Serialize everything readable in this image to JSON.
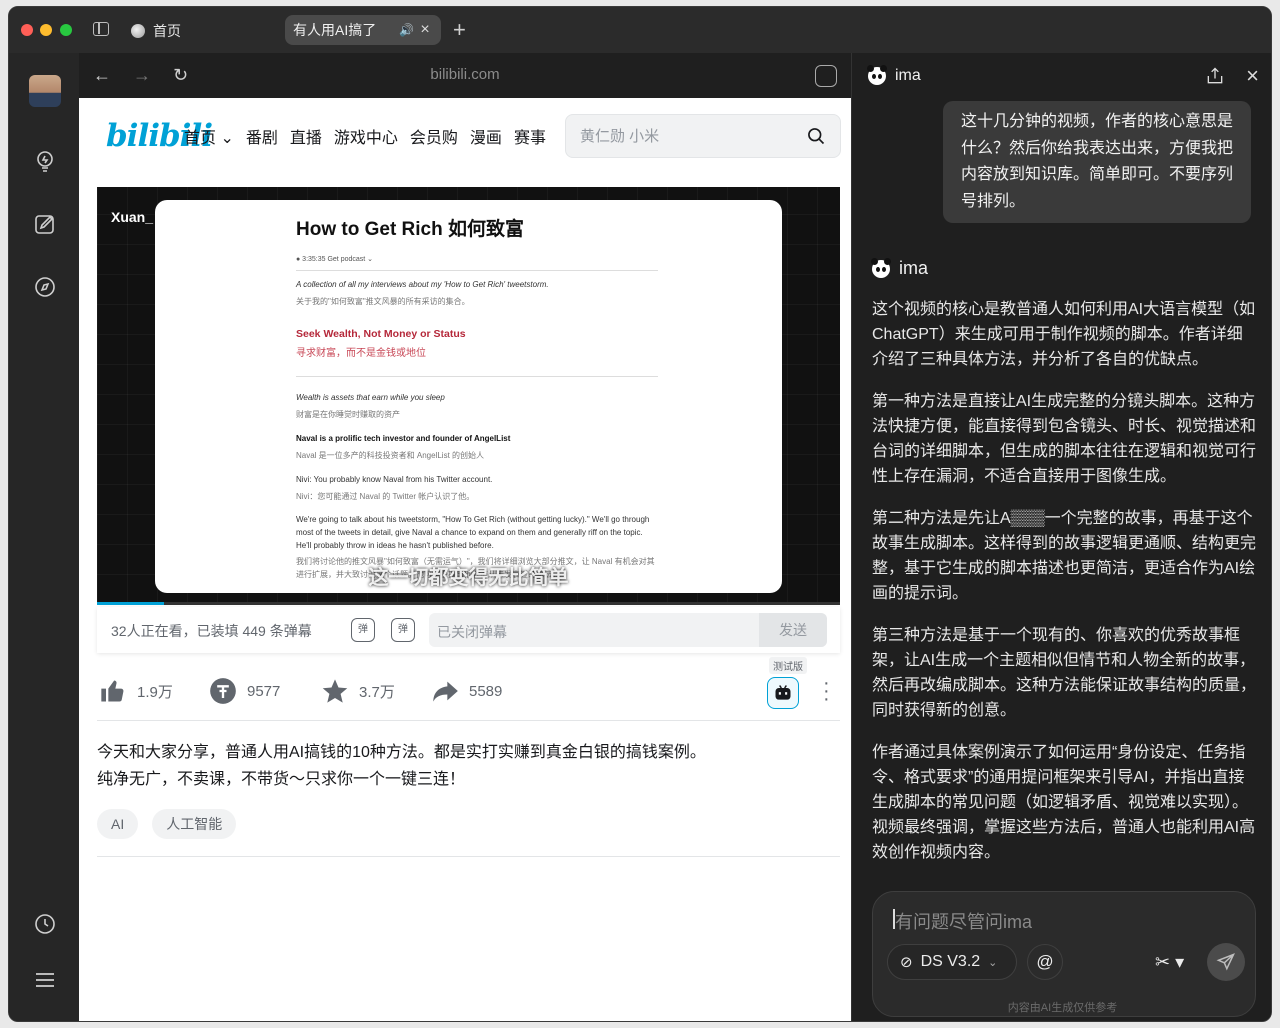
{
  "window": {
    "tabs": [
      {
        "label": "首页"
      },
      {
        "label": "有人用AI搞了"
      }
    ]
  },
  "browser": {
    "url": "bilibili.com"
  },
  "bilibili": {
    "logo": "bilibili",
    "nav": [
      "首页 ⌄",
      "番剧",
      "直播",
      "游戏中心",
      "会员购",
      "漫画",
      "赛事"
    ],
    "search_placeholder": "黄仁勋 小米",
    "video": {
      "watermark": "Xuan_",
      "watermark_logo": "bilibili",
      "slide_title": "How to Get Rich 如何致富",
      "slide_meta": "● 3:35:35   Get podcast ⌄",
      "slide_lines": {
        "l1": "A collection of all my interviews about my 'How to Get Rich' tweetstorm.",
        "l2": "关于我的\"如何致富\"推文风暴的所有采访的集合。",
        "l3": "Seek Wealth, Not Money or Status",
        "l4": "寻求财富，而不是金钱或地位",
        "l5": "Wealth is assets that earn while you sleep",
        "l6": "财富是在你睡觉时赚取的资产",
        "l7": "Naval is a prolific tech investor and founder of AngelList",
        "l8": "Naval 是一位多产的科技投资者和 AngelList 的创始人",
        "l9": "Nivi: You probably know Naval from his Twitter account.",
        "l10": "Nivi：您可能通过 Naval 的 Twitter 帐户认识了他。",
        "l11": "We're going to talk about his tweetstorm, \"How To Get Rich (without getting lucky).\" We'll go through most of the tweets in detail, give Naval a chance to expand on them and generally riff on the topic. He'll probably throw in ideas he hasn't published before.",
        "l12": "我们将讨论他的推文风暴\"如何致富（无需运气）\"，我们将详细浏览大部分推文，让 Naval 有机会对其进行扩展，并大致讨论这个话题。他可能会提出他以前从未发表过的想法。"
      },
      "subtitle": "这一切都变得无比简单"
    },
    "danmaku": {
      "info": "32人正在看，已装填 449 条弹幕",
      "placeholder": "已关闭弹幕",
      "send": "发送"
    },
    "actions": {
      "like": "1.9万",
      "coin": "9577",
      "favorite": "3.7万",
      "share": "5589",
      "ai_tag": "测试版"
    },
    "description": [
      "今天和大家分享，普通人用AI搞钱的10种方法。都是实打实赚到真金白银的搞钱案例。",
      "纯净无广，不卖课，不带货～只求你一个一键三连！"
    ],
    "tags": [
      "AI",
      "人工智能"
    ]
  },
  "assistant": {
    "name": "ima",
    "user_message": "这十几分钟的视频，作者的核心意思是什么？然后你给我表达出来，方便我把内容放到知识库。简单即可。不要序列号排列。",
    "reply_name": "ima",
    "reply_paragraphs": [
      "这个视频的核心是教普通人如何利用AI大语言模型（如ChatGPT）来生成可用于制作视频的脚本。作者详细介绍了三种具体方法，并分析了各自的优缺点。",
      "第一种方法是直接让AI生成完整的分镜头脚本。这种方法快捷方便，能直接得到包含镜头、时长、视觉描述和台词的详细脚本，但生成的脚本往往在逻辑和视觉可行性上存在漏洞，不适合直接用于图像生成。",
      "第二种方法是先让A▒▒▒一个完整的故事，再基于这个故事生成脚本。这样得到的故事逻辑更通顺、结构更完整，基于它生成的脚本描述也更简洁，更适合作为AI绘画的提示词。",
      "第三种方法是基于一个现有的、你喜欢的优秀故事框架，让AI生成一个主题相似但情节和人物全新的故事，然后再改编成脚本。这种方法能保证故事结构的质量，同时获得新的创意。",
      "作者通过具体案例演示了如何运用“身份设定、任务指令、格式要求”的通用提问框架来引导AI，并指出直接生成脚本的常见问题（如逻辑矛盾、视觉难以实现）。视频最终强调，掌握这些方法后，普通人也能利用AI高效创作视频内容。"
    ],
    "composer_placeholder": "有问题尽管问ima",
    "model": "DS V3.2",
    "at_label": "@",
    "disclaimer": "内容由AI生成仅供参考"
  }
}
